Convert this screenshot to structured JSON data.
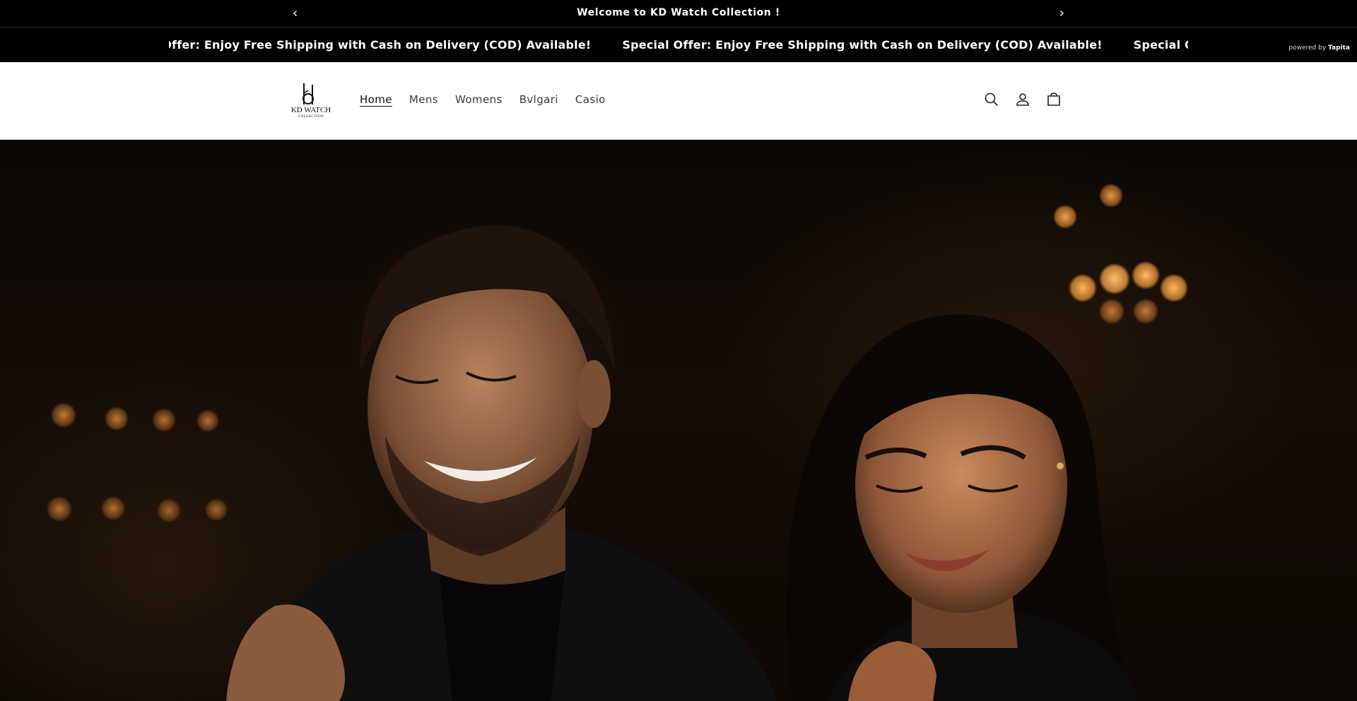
{
  "announcement": {
    "message": "Welcome to KD Watch Collection !",
    "prev_icon": "chevron-left-icon",
    "next_icon": "chevron-right-icon"
  },
  "marquee": {
    "text_partial": "ping with Cash on Delivery (COD) Available!",
    "text_full": "Special Offer: Enjoy Free Shipping with Cash on Delivery (COD) Available!",
    "text_cut": "Special Offer: Enjoy Free Shipping with Cash on Delivery (COD) Available!",
    "powered_prefix": "powered by",
    "powered_brand": "Tapita"
  },
  "header": {
    "logo_text": "KD WATCH",
    "logo_subtext": "COLLECTION",
    "nav": [
      {
        "label": "Home",
        "active": true
      },
      {
        "label": "Mens"
      },
      {
        "label": "Womens"
      },
      {
        "label": "Bvlgari"
      },
      {
        "label": "Casio"
      }
    ],
    "icons": [
      "search-icon",
      "account-icon",
      "cart-icon"
    ]
  },
  "hero": {
    "image": "couple-smiling-dark-luxury-background"
  },
  "colors": {
    "bar_bg": "#000000",
    "header_bg": "#ffffff",
    "text_dark": "#3a3a3a",
    "bokeh": "#e89a3c"
  }
}
